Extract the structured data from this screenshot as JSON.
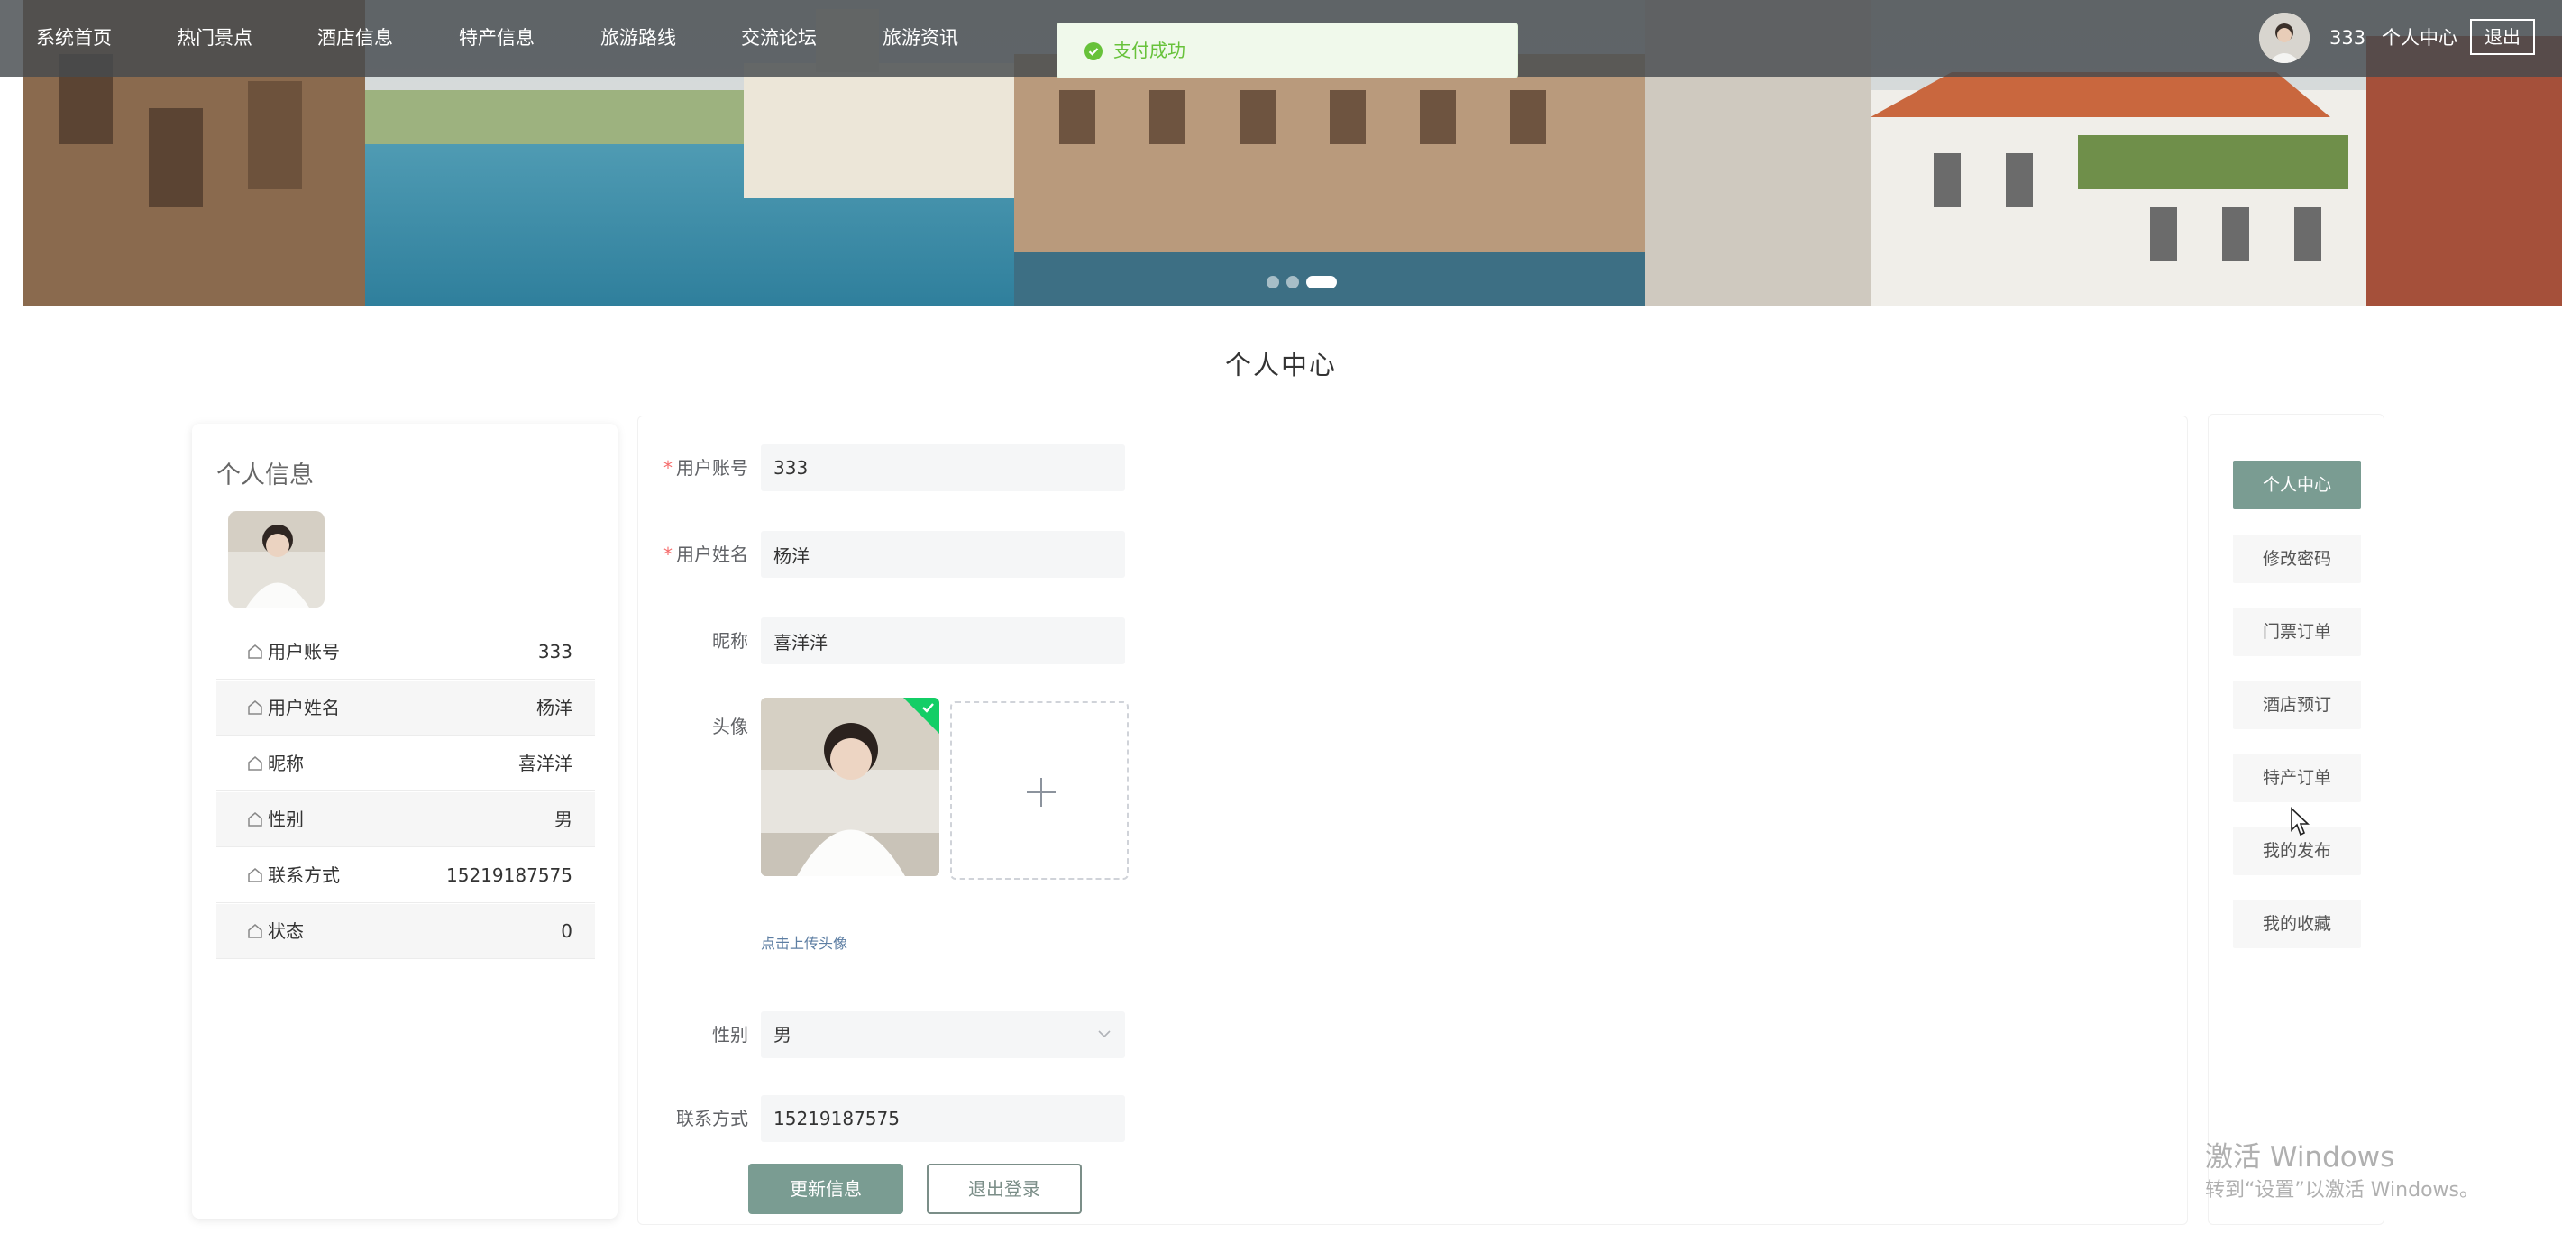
{
  "nav": {
    "items": [
      "系统首页",
      "热门景点",
      "酒店信息",
      "特产信息",
      "旅游路线",
      "交流论坛",
      "旅游资讯"
    ],
    "user_name": "333",
    "center_label": "个人中心",
    "logout_label": "退出"
  },
  "toast": {
    "text": "支付成功",
    "icon": "success-check-icon",
    "color": "#67c23a"
  },
  "banner": {
    "image": "venice-canal-photo",
    "dots": 3,
    "active_dot": 3
  },
  "page": {
    "title": "个人中心"
  },
  "profile": {
    "title": "个人信息",
    "rows": [
      {
        "label": "用户账号",
        "value": "333"
      },
      {
        "label": "用户姓名",
        "value": "杨洋"
      },
      {
        "label": "昵称",
        "value": "喜洋洋"
      },
      {
        "label": "性别",
        "value": "男"
      },
      {
        "label": "联系方式",
        "value": "15219187575"
      },
      {
        "label": "状态",
        "value": "0"
      }
    ]
  },
  "form": {
    "account": {
      "label": "用户账号",
      "value": "333",
      "required": true
    },
    "name": {
      "label": "用户姓名",
      "value": "杨洋",
      "required": true
    },
    "nickname": {
      "label": "昵称",
      "value": "喜洋洋"
    },
    "avatar": {
      "label": "头像",
      "hint": "点击上传头像"
    },
    "gender": {
      "label": "性别",
      "value": "男"
    },
    "phone": {
      "label": "联系方式",
      "value": "15219187575"
    },
    "update_button": "更新信息",
    "logout_button": "退出登录"
  },
  "side_menu": {
    "items": [
      "个人中心",
      "修改密码",
      "门票订单",
      "酒店预订",
      "特产订单",
      "我的发布",
      "我的收藏"
    ],
    "active_index": 0
  },
  "watermark": {
    "line1": "激活 Windows",
    "line2": "转到“设置”以激活 Windows。"
  },
  "colors": {
    "accent": "#7a9c92",
    "nav_bg": "#464a4e",
    "success": "#67c23a",
    "required": "#f56c6c"
  }
}
